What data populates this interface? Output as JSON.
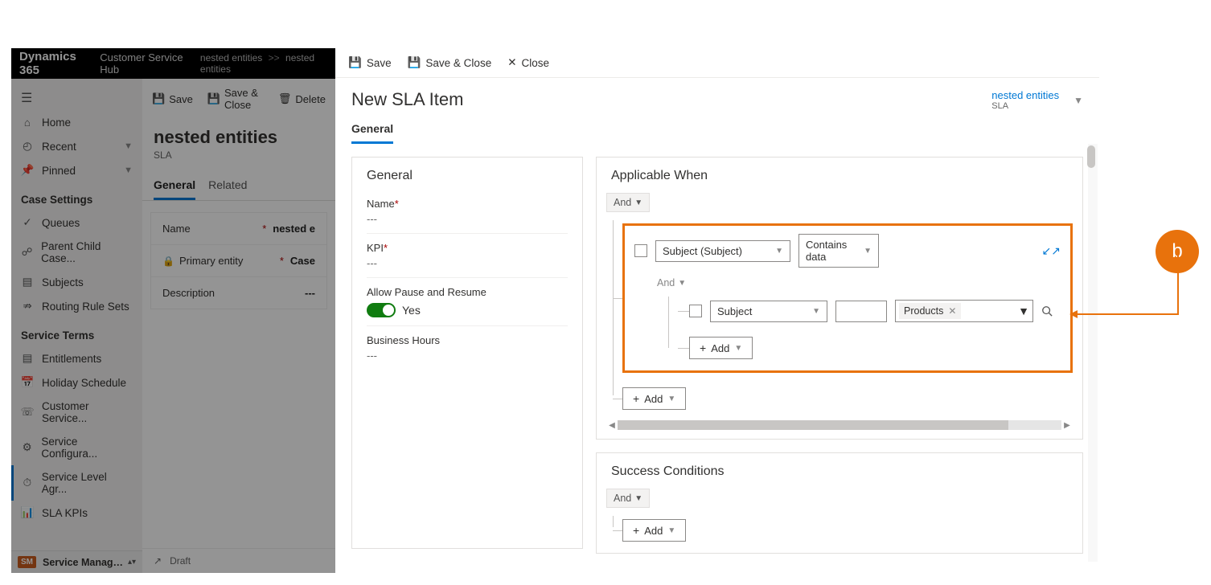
{
  "header": {
    "app": "Dynamics 365",
    "hub": "Customer Service Hub",
    "breadcrumb1": "nested entities",
    "breadcrumb2": "nested entities"
  },
  "sidebar": {
    "home": "Home",
    "recent": "Recent",
    "pinned": "Pinned",
    "section_case": "Case Settings",
    "queues": "Queues",
    "parent_child": "Parent Child Case...",
    "subjects": "Subjects",
    "routing": "Routing Rule Sets",
    "section_service": "Service Terms",
    "entitlements": "Entitlements",
    "holiday": "Holiday Schedule",
    "customer_service": "Customer Service...",
    "service_config": "Service Configura...",
    "sla": "Service Level Agr...",
    "sla_kpis": "SLA KPIs",
    "app_picker_badge": "SM",
    "app_picker": "Service Managem..."
  },
  "bg_detail": {
    "save": "Save",
    "save_close": "Save & Close",
    "delete": "Delete",
    "title": "nested entities",
    "subtitle": "SLA",
    "tab_general": "General",
    "tab_related": "Related",
    "f_name": "Name",
    "f_name_val": "nested e",
    "f_primary": "Primary entity",
    "f_primary_val": "Case",
    "f_desc": "Description",
    "f_desc_val": "---",
    "status": "Draft"
  },
  "flyout": {
    "cmd_save": "Save",
    "cmd_save_close": "Save & Close",
    "cmd_close": "Close",
    "title": "New SLA Item",
    "header_link": "nested entities",
    "header_sub": "SLA",
    "tab_general": "General",
    "general_card_title": "General",
    "f_name": "Name",
    "f_name_val": "---",
    "f_kpi": "KPI",
    "f_kpi_val": "---",
    "f_allow": "Allow Pause and Resume",
    "f_allow_val": "Yes",
    "f_bh": "Business Hours",
    "f_bh_val": "---"
  },
  "applicable": {
    "title": "Applicable When",
    "and": "And",
    "subject_subject": "Subject (Subject)",
    "contains_data": "Contains data",
    "inner_and": "And",
    "subject": "Subject",
    "tag_products": "Products",
    "add": "Add"
  },
  "success": {
    "title": "Success Conditions",
    "and": "And",
    "add": "Add"
  },
  "annotation": {
    "label": "b"
  }
}
